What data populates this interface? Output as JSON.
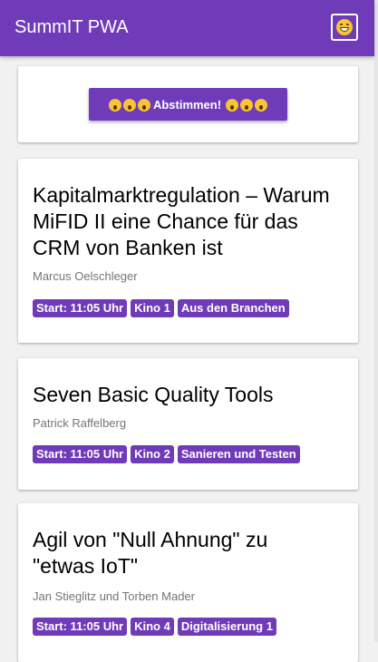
{
  "app": {
    "title": "SummIT PWA",
    "profile_icon": "grinning-face-icon"
  },
  "vote": {
    "label": "Abstimmen!",
    "icon": "screaming-face-icon"
  },
  "talks": [
    {
      "title": "Kapitalmarktregulation – Warum MiFID II eine Chance für das CRM von Banken ist",
      "speaker": "Marcus Oelschleger",
      "tags": [
        "Start: 11:05 Uhr",
        "Kino 1",
        "Aus den Branchen"
      ]
    },
    {
      "title": "Seven Basic Quality Tools",
      "speaker": "Patrick Raffelberg",
      "tags": [
        "Start: 11:05 Uhr",
        "Kino 2",
        "Sanieren und Testen"
      ]
    },
    {
      "title": "Agil von \"Null Ahnung\" zu \"etwas IoT\"",
      "speaker": "Jan Stieglitz und Torben Mader",
      "tags": [
        "Start: 11:05 Uhr",
        "Kino 4",
        "Digitalisierung 1"
      ]
    }
  ],
  "colors": {
    "primary": "#6f3bb8",
    "background": "#f1f1f1",
    "card": "#ffffff",
    "speaker_text": "#757575"
  }
}
